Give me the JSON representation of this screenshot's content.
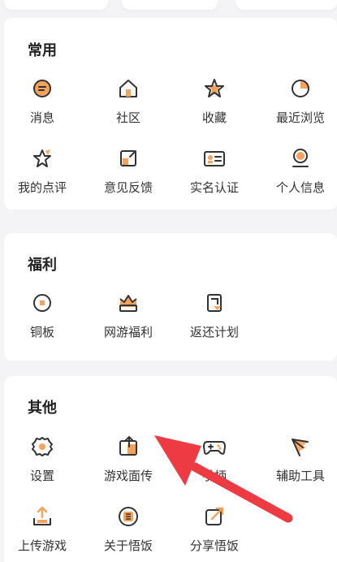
{
  "sections": {
    "common": {
      "title": "常用",
      "items": [
        {
          "label": "消息",
          "icon": "message-icon"
        },
        {
          "label": "社区",
          "icon": "home-icon"
        },
        {
          "label": "收藏",
          "icon": "star-icon"
        },
        {
          "label": "最近浏览",
          "icon": "history-icon"
        },
        {
          "label": "我的点评",
          "icon": "review-icon"
        },
        {
          "label": "意见反馈",
          "icon": "feedback-icon"
        },
        {
          "label": "实名认证",
          "icon": "id-card-icon"
        },
        {
          "label": "个人信息",
          "icon": "person-icon"
        }
      ]
    },
    "welfare": {
      "title": "福利",
      "items": [
        {
          "label": "铜板",
          "icon": "coin-icon"
        },
        {
          "label": "网游福利",
          "icon": "gift-icon"
        },
        {
          "label": "返还计划",
          "icon": "rebate-icon"
        }
      ]
    },
    "other": {
      "title": "其他",
      "items": [
        {
          "label": "设置",
          "icon": "gear-icon"
        },
        {
          "label": "游戏面传",
          "icon": "upload-box-icon"
        },
        {
          "label": "手柄",
          "icon": "gamepad-icon"
        },
        {
          "label": "辅助工具",
          "icon": "tool-icon"
        },
        {
          "label": "上传游戏",
          "icon": "upload-icon"
        },
        {
          "label": "关于悟饭",
          "icon": "info-icon"
        },
        {
          "label": "分享悟饭",
          "icon": "share-icon"
        }
      ]
    }
  },
  "colors": {
    "accent": "#f5a25d",
    "stroke": "#3a3a3a",
    "arrow": "#ee3a43"
  }
}
